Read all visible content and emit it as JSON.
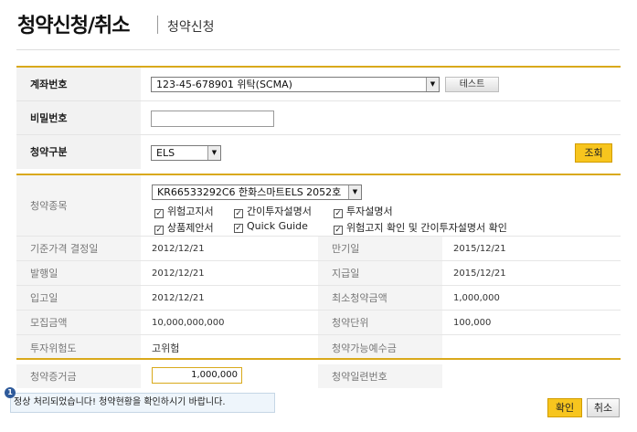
{
  "header": {
    "title": "청약신청/취소",
    "subtitle": "청약신청"
  },
  "topform": {
    "account_label": "계좌번호",
    "account_value": "123-45-678901 위탁(SCMA)",
    "test_button": "테스트",
    "password_label": "비밀번호",
    "password_value": "",
    "type_label": "청약구분",
    "type_value": "ELS",
    "inquiry_button": "조회"
  },
  "detail": {
    "item_label": "청약종목",
    "item_value": "KR66533292C6   한화스마트ELS 2052호",
    "checks": [
      {
        "label": "위험고지서",
        "checked": true
      },
      {
        "label": "간이투자설명서",
        "checked": true
      },
      {
        "label": "투자설명서",
        "checked": true
      },
      {
        "label": "상품제안서",
        "checked": true
      },
      {
        "label": "Quick Guide",
        "checked": true
      },
      {
        "label": "위험고지 확인 및 간이투자설명서 확인",
        "checked": true
      }
    ],
    "rows": [
      {
        "l1": "기준가격 결정일",
        "v1": "2012/12/21",
        "l2": "만기일",
        "v2": "2015/12/21"
      },
      {
        "l1": "발행일",
        "v1": "2012/12/21",
        "l2": "지급일",
        "v2": "2015/12/21"
      },
      {
        "l1": "입고일",
        "v1": "2012/12/21",
        "l2": "최소청약금액",
        "v2": "1,000,000"
      },
      {
        "l1": "모집금액",
        "v1": "10,000,000,000",
        "l2": "청약단위",
        "v2": "100,000"
      },
      {
        "l1": "투자위험도",
        "v1": "고위험",
        "l2": "청약가능예수금",
        "v2": ""
      }
    ]
  },
  "deposit": {
    "label": "청약증거금",
    "amount": "1,000,000",
    "serial_label": "청약일련번호",
    "serial_value": ""
  },
  "message": {
    "badge": "1",
    "text": "정상 처리되었습니다! 청약현황을 확인하시기 바랍니다."
  },
  "buttons": {
    "confirm": "확인",
    "cancel": "취소"
  },
  "colors": {
    "accent": "#d9a91b",
    "button_yellow": "#f7c51e",
    "label_bg": "#f2f2f2",
    "message_bg": "#eef5fb"
  }
}
